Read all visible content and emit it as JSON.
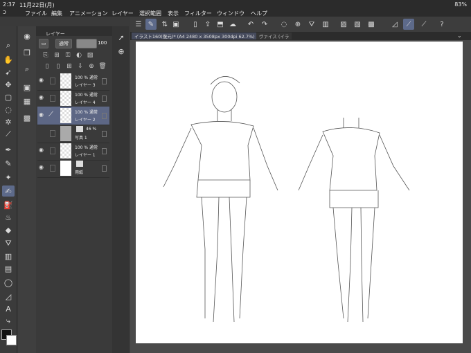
{
  "status": {
    "time": "2:37",
    "date": "11月22日(月)",
    "battery": "83%"
  },
  "menu": [
    "ファイル",
    "編集",
    "アニメーション",
    "レイヤー",
    "選択範囲",
    "表示",
    "フィルター",
    "ウィンドウ",
    "ヘルプ"
  ],
  "layer_panel": {
    "tab_label": "レイヤー",
    "blend_mode": "通常",
    "opacity": "100",
    "layers": [
      {
        "mode": "100 %  通常",
        "name": "レイヤー 3",
        "visible": true,
        "selected": false,
        "thumb": "transparent"
      },
      {
        "mode": "100 %  通常",
        "name": "レイヤー 4",
        "visible": true,
        "selected": false,
        "thumb": "transparent"
      },
      {
        "mode": "100 %  通常",
        "name": "レイヤー 2",
        "visible": true,
        "selected": true,
        "thumb": "transparent"
      },
      {
        "mode": "46 %",
        "name": "写真 1",
        "visible": false,
        "selected": false,
        "thumb": "photo"
      },
      {
        "mode": "100 %  通常",
        "name": "レイヤー 1",
        "visible": true,
        "selected": false,
        "thumb": "transparent"
      },
      {
        "mode": "",
        "name": "用紙",
        "visible": true,
        "selected": false,
        "thumb": "plain"
      }
    ]
  },
  "doc_tabs": {
    "active": "イラスト160(復元)* (A4 2480 x 3508px 300dpi 62.7%)",
    "other": "ヴァイス (イラ"
  },
  "colors": {
    "accent": "#5d6a8a",
    "main_color": "#111111",
    "sub_color": "#ffffff"
  }
}
